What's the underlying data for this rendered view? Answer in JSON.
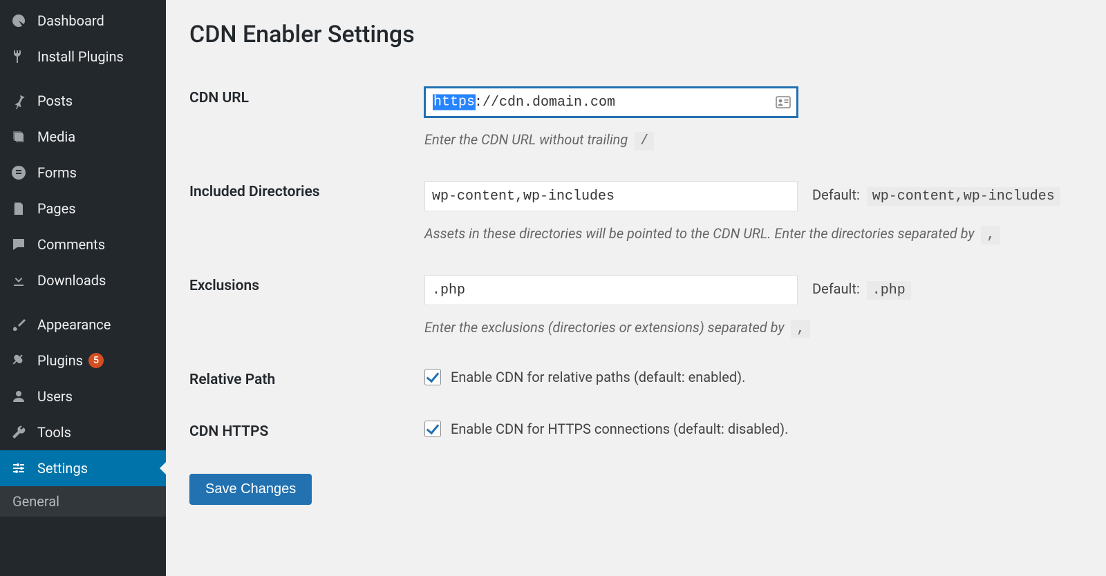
{
  "sidebar": {
    "items": [
      {
        "id": "dashboard",
        "label": "Dashboard",
        "icon": "dashboard"
      },
      {
        "id": "installplug",
        "label": "Install Plugins",
        "icon": "plug"
      },
      {
        "id": "posts",
        "label": "Posts",
        "icon": "pin",
        "spacer_before": true
      },
      {
        "id": "media",
        "label": "Media",
        "icon": "media"
      },
      {
        "id": "forms",
        "label": "Forms",
        "icon": "forms"
      },
      {
        "id": "pages",
        "label": "Pages",
        "icon": "pages"
      },
      {
        "id": "comments",
        "label": "Comments",
        "icon": "comment"
      },
      {
        "id": "downloads",
        "label": "Downloads",
        "icon": "download"
      },
      {
        "id": "appearance",
        "label": "Appearance",
        "icon": "brush",
        "spacer_before": true
      },
      {
        "id": "plugins",
        "label": "Plugins",
        "icon": "plugin",
        "badge": "5"
      },
      {
        "id": "users",
        "label": "Users",
        "icon": "user"
      },
      {
        "id": "tools",
        "label": "Tools",
        "icon": "wrench"
      },
      {
        "id": "settings",
        "label": "Settings",
        "icon": "sliders",
        "active": true
      }
    ],
    "sub": {
      "label": "General"
    }
  },
  "page": {
    "title": "CDN Enabler Settings",
    "save_label": "Save Changes"
  },
  "fields": {
    "cdn_url": {
      "label": "CDN URL",
      "value": "https://cdn.domain.com",
      "selected_prefix": "https",
      "help_text": "Enter the CDN URL without trailing",
      "help_code": "/"
    },
    "included_dirs": {
      "label": "Included Directories",
      "value": "wp-content,wp-includes",
      "default_prefix": "Default:",
      "default_code": "wp-content,wp-includes",
      "help_text": "Assets in these directories will be pointed to the CDN URL. Enter the directories separated by",
      "help_code": ","
    },
    "exclusions": {
      "label": "Exclusions",
      "value": ".php",
      "default_prefix": "Default:",
      "default_code": ".php",
      "help_text": "Enter the exclusions (directories or extensions) separated by",
      "help_code": ","
    },
    "relative_path": {
      "label": "Relative Path",
      "checked": true,
      "checkbox_label": "Enable CDN for relative paths (default: enabled)."
    },
    "cdn_https": {
      "label": "CDN HTTPS",
      "checked": true,
      "checkbox_label": "Enable CDN for HTTPS connections (default: disabled)."
    }
  }
}
